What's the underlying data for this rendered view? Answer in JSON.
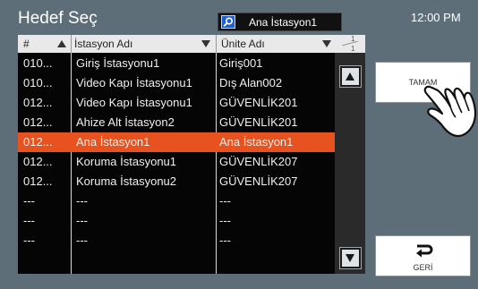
{
  "header": {
    "title": "Hedef Seç",
    "clock": "12:00 PM"
  },
  "search": {
    "value": "Ana İstasyon1"
  },
  "table": {
    "columns": {
      "number": "#",
      "station": "İstasyon Adı",
      "unit": "Ünite Adı"
    },
    "rows": [
      {
        "number": "010...",
        "station": "Giriş İstasyonu1",
        "unit": "Giriş001",
        "selected": false
      },
      {
        "number": "010...",
        "station": "Video Kapı İstasyonu1",
        "unit": "Dış Alan002",
        "selected": false
      },
      {
        "number": "012...",
        "station": "Video Kapı İstasyonu1",
        "unit": "GÜVENLİK201",
        "selected": false
      },
      {
        "number": "012...",
        "station": "Ahize Alt İstasyon2",
        "unit": "GÜVENLİK201",
        "selected": false
      },
      {
        "number": "012...",
        "station": "Ana İstasyon1",
        "unit": "Ana İstasyon1",
        "selected": true
      },
      {
        "number": "012...",
        "station": "Koruma İstasyonu1",
        "unit": "GÜVENLİK207",
        "selected": false
      },
      {
        "number": "012...",
        "station": "Koruma İstasyonu2",
        "unit": "GÜVENLİK207",
        "selected": false
      },
      {
        "number": "---",
        "station": "---",
        "unit": "---",
        "selected": false
      },
      {
        "number": "---",
        "station": "---",
        "unit": "---",
        "selected": false
      },
      {
        "number": "---",
        "station": "---",
        "unit": "---",
        "selected": false
      }
    ]
  },
  "pager": {
    "current": "1",
    "total": "1"
  },
  "buttons": {
    "ok": "TAMAM",
    "back": "GERİ"
  },
  "colors": {
    "background": "#5e6e79",
    "selected_row": "#e8521f",
    "table": "#050505",
    "header": "#e9e9e9"
  }
}
